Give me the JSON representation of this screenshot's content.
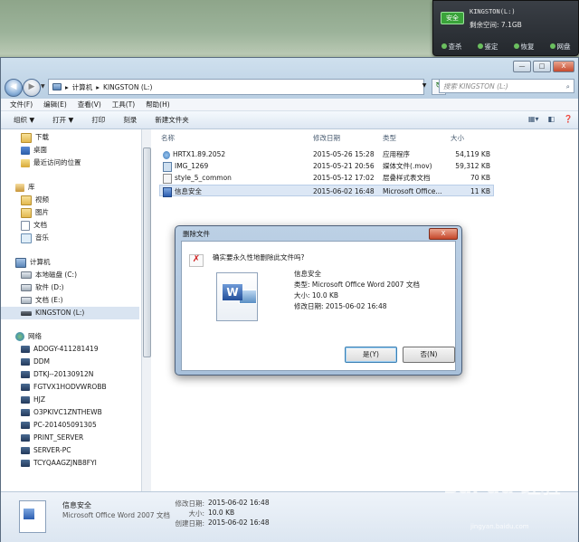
{
  "usb_popup": {
    "badge": "安全",
    "drive_name": "KINGSTON(L:)",
    "free_space": "剩余空间: 7.1GB",
    "actions": [
      "查杀",
      "鉴定",
      "恢复",
      "网盘"
    ]
  },
  "window": {
    "title_buttons": [
      "—",
      "□",
      "X"
    ],
    "address": {
      "segments": [
        "计算机",
        "KINGSTON (L:)"
      ]
    },
    "search_placeholder": "搜索 KINGSTON (L:)",
    "menubar": [
      "文件(F)",
      "编辑(E)",
      "查看(V)",
      "工具(T)",
      "帮助(H)"
    ],
    "toolbar": [
      "组织 ▼",
      "打开 ▼",
      "打印",
      "刻录",
      "新建文件夹"
    ]
  },
  "nav_pane": {
    "items": [
      {
        "label": "下载",
        "icon": "folder-icon"
      },
      {
        "label": "桌面",
        "icon": "desktop-icon"
      },
      {
        "label": "最近访问的位置",
        "icon": "recent-icon"
      },
      {
        "label": "库",
        "icon": "library-icon"
      },
      {
        "label": "视频",
        "icon": "video-icon"
      },
      {
        "label": "图片",
        "icon": "picture-icon"
      },
      {
        "label": "文档",
        "icon": "document-icon"
      },
      {
        "label": "音乐",
        "icon": "music-icon"
      },
      {
        "label": "计算机",
        "icon": "computer-icon"
      },
      {
        "label": "本地磁盘 (C:)",
        "icon": "drive-icon"
      },
      {
        "label": "软件 (D:)",
        "icon": "drive-icon"
      },
      {
        "label": "文档 (E:)",
        "icon": "drive-icon"
      },
      {
        "label": "KINGSTON (L:)",
        "icon": "usb-drive-icon"
      },
      {
        "label": "网络",
        "icon": "network-icon"
      },
      {
        "label": "ADOGY-411281419",
        "icon": "host-icon"
      },
      {
        "label": "DDM",
        "icon": "host-icon"
      },
      {
        "label": "DTKJ--20130912N",
        "icon": "host-icon"
      },
      {
        "label": "FGTVX1HODVWROBB",
        "icon": "host-icon"
      },
      {
        "label": "HJZ",
        "icon": "host-icon"
      },
      {
        "label": "O3PKIVC1ZNTHEWB",
        "icon": "host-icon"
      },
      {
        "label": "PC-201405091305",
        "icon": "host-icon"
      },
      {
        "label": "PRINT_SERVER",
        "icon": "host-icon"
      },
      {
        "label": "SERVER-PC",
        "icon": "host-icon"
      },
      {
        "label": "TCYQAAGZJNB8FYI",
        "icon": "host-icon"
      }
    ]
  },
  "file_list": {
    "columns": [
      "名称",
      "修改日期",
      "类型",
      "大小"
    ],
    "rows": [
      {
        "name": "HRTX1.89.2052",
        "date": "2015-05-26 15:28",
        "type": "应用程序",
        "size": "54,119 KB",
        "icon": "exe-icon"
      },
      {
        "name": "IMG_1269",
        "date": "2015-05-21 20:56",
        "type": "媒体文件(.mov)",
        "size": "59,312 KB",
        "icon": "movie-icon"
      },
      {
        "name": "style_5_common",
        "date": "2015-05-12 17:02",
        "type": "层叠样式表文档",
        "size": "70 KB",
        "icon": "css-icon"
      },
      {
        "name": "信息安全",
        "date": "2015-06-02 16:48",
        "type": "Microsoft Office...",
        "size": "11 KB",
        "icon": "word-icon"
      }
    ]
  },
  "details_pane": {
    "name": "信息安全",
    "type": "Microsoft Office Word 2007 文档",
    "modified_label": "修改日期:",
    "modified": "2015-06-02 16:48",
    "size_label": "大小:",
    "size": "10.0 KB",
    "created_label": "创建日期:",
    "created": "2015-06-02 16:48"
  },
  "dialog": {
    "title": "删除文件",
    "close_label": "X",
    "question": "确实要永久性地删除此文件吗?",
    "file_name": "信息安全",
    "file_type": "类型: Microsoft Office Word 2007 文档",
    "file_size": "大小: 10.0 KB",
    "file_modified": "修改日期: 2015-06-02 16:48",
    "yes": "是(Y)",
    "no": "否(N)"
  },
  "watermark": {
    "brand": "Bai du 经验",
    "url": "jingyan.baidu.com"
  }
}
